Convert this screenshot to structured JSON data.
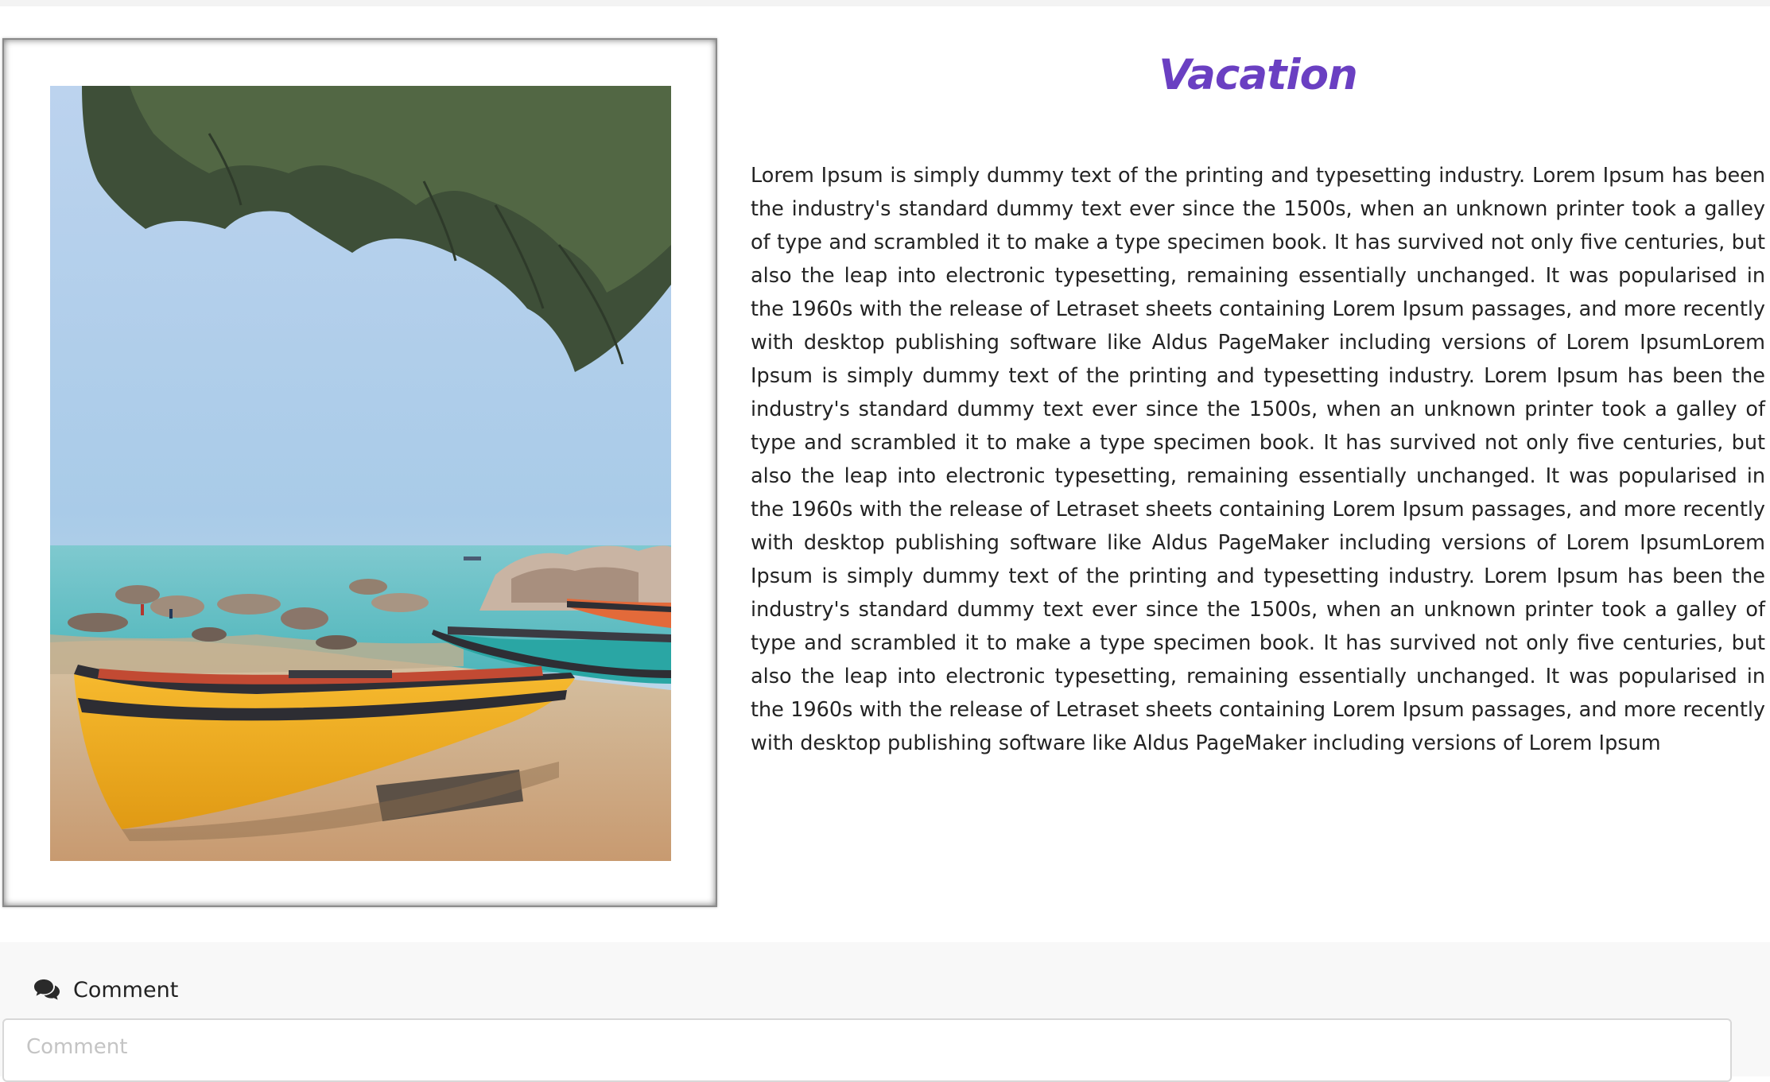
{
  "article": {
    "title": "Vacation",
    "body": "Lorem Ipsum is simply dummy text of the printing and typesetting industry. Lorem Ipsum has been the industry's standard dummy text ever since the 1500s, when an unknown printer took a galley of type and scrambled it to make a type specimen book. It has survived not only five centuries, but also the leap into electronic typesetting, remaining essentially unchanged. It was popularised in the 1960s with the release of Letraset sheets containing Lorem Ipsum passages, and more recently with desktop publishing software like Aldus PageMaker including versions of Lorem IpsumLorem Ipsum is simply dummy text of the printing and typesetting industry. Lorem Ipsum has been the industry's standard dummy text ever since the 1500s, when an unknown printer took a galley of type and scrambled it to make a type specimen book. It has survived not only five centuries, but also the leap into electronic typesetting, remaining essentially unchanged. It was popularised in the 1960s with the release of Letraset sheets containing Lorem Ipsum passages, and more recently with desktop publishing software like Aldus PageMaker including versions of Lorem IpsumLorem Ipsum is simply dummy text of the printing and typesetting industry. Lorem Ipsum has been the industry's standard dummy text ever since the 1500s, when an unknown printer took a galley of type and scrambled it to make a type specimen book. It has survived not only five centuries, but also the leap into electronic typesetting, remaining essentially unchanged. It was popularised in the 1960s with the release of Letraset sheets containing Lorem Ipsum passages, and more recently with desktop publishing software like Aldus PageMaker including versions of Lorem Ipsum",
    "photo_icon": "beach-boats-photo"
  },
  "comment": {
    "label": "Comment",
    "icon": "comments-icon",
    "input_value": "",
    "input_placeholder": "Comment"
  },
  "colors": {
    "title": "#6a3fc2",
    "body_text": "#232323",
    "comment_section_bg": "#f8f8f8"
  }
}
